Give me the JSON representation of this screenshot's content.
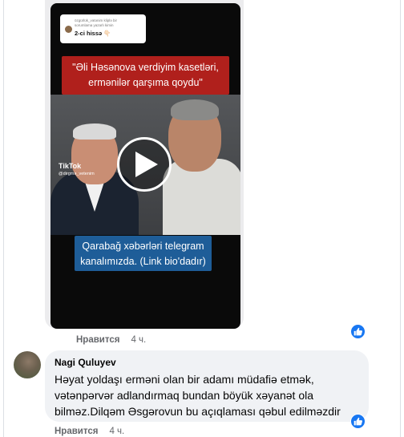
{
  "post": {
    "video": {
      "reply_label_small": "özgürlük_vətənim kliplə bir",
      "reply_label_small_2": "sorumlama yazarlı kimin",
      "reply_label_main": "2-ci hissə 👇🏻",
      "quote_line1": "\"Əli Həsənova verdiyim kasetləri,",
      "quote_line2": "ermənilər qarşıma qoydu\"",
      "tiktok_logo": "TikTok",
      "tiktok_user": "@dirgmə_vetenim",
      "caption_line1": "Qarabağ xəbərləri telegram",
      "caption_line2": "kanalımızda. (Link bio'dadır)"
    },
    "actions": {
      "like_label": "Нравится",
      "time": "4 ч."
    }
  },
  "comment": {
    "author": "Nagi Quluyev",
    "text": "Həyat yoldaşı erməni olan bir adamı müdafiə etmək, vətənpərvər adlandırmaq bundan böyük xəyanət ola bilməz.Dilqəm Əsgərovun bu açıqlaması qəbul edilməzdir",
    "actions": {
      "like_label": "Нравится",
      "time": "4 ч."
    }
  },
  "colors": {
    "quote_bg": "#b0201c",
    "caption_bg": "#1e5d98",
    "like_blue": "#1877f2",
    "bubble_bg": "#f0f2f5"
  },
  "icons": [
    "play-icon",
    "thumbs-up-icon",
    "tiktok-icon"
  ]
}
